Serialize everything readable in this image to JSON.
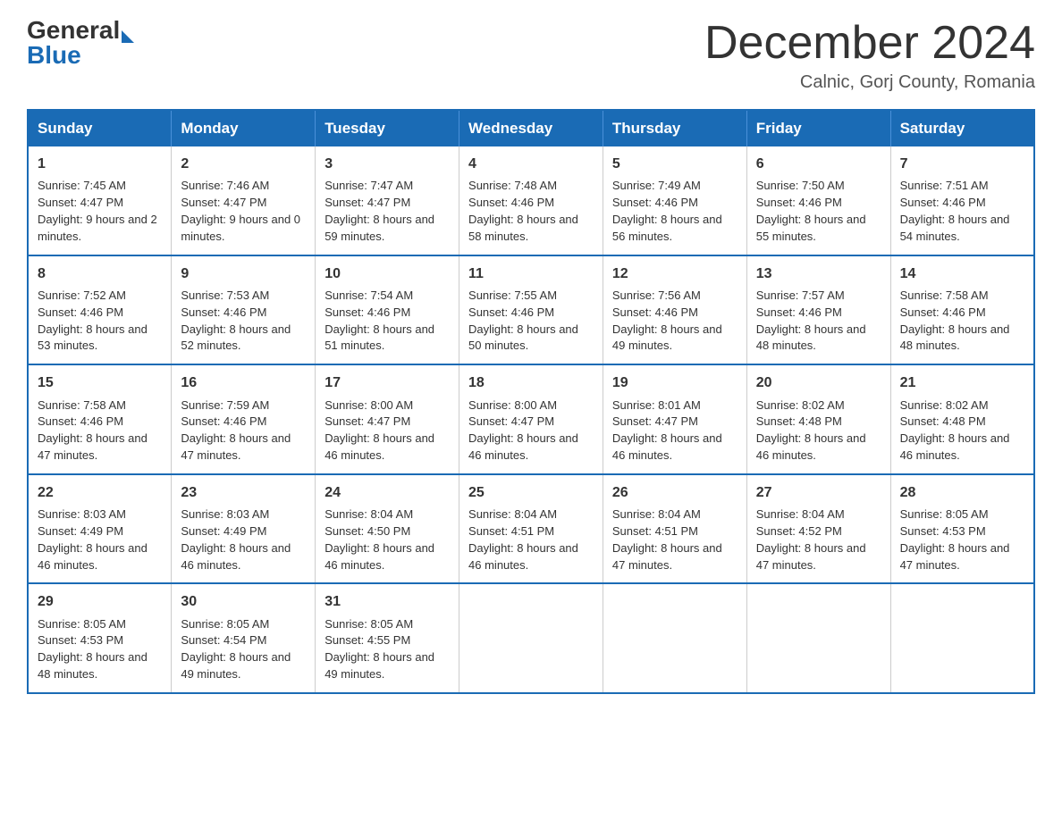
{
  "header": {
    "logo": {
      "general": "General",
      "blue": "Blue",
      "arrow_color": "#1a6bb5"
    },
    "title": "December 2024",
    "subtitle": "Calnic, Gorj County, Romania"
  },
  "days_of_week": [
    "Sunday",
    "Monday",
    "Tuesday",
    "Wednesday",
    "Thursday",
    "Friday",
    "Saturday"
  ],
  "weeks": [
    [
      {
        "day": "1",
        "sunrise": "7:45 AM",
        "sunset": "4:47 PM",
        "daylight": "9 hours and 2 minutes."
      },
      {
        "day": "2",
        "sunrise": "7:46 AM",
        "sunset": "4:47 PM",
        "daylight": "9 hours and 0 minutes."
      },
      {
        "day": "3",
        "sunrise": "7:47 AM",
        "sunset": "4:47 PM",
        "daylight": "8 hours and 59 minutes."
      },
      {
        "day": "4",
        "sunrise": "7:48 AM",
        "sunset": "4:46 PM",
        "daylight": "8 hours and 58 minutes."
      },
      {
        "day": "5",
        "sunrise": "7:49 AM",
        "sunset": "4:46 PM",
        "daylight": "8 hours and 56 minutes."
      },
      {
        "day": "6",
        "sunrise": "7:50 AM",
        "sunset": "4:46 PM",
        "daylight": "8 hours and 55 minutes."
      },
      {
        "day": "7",
        "sunrise": "7:51 AM",
        "sunset": "4:46 PM",
        "daylight": "8 hours and 54 minutes."
      }
    ],
    [
      {
        "day": "8",
        "sunrise": "7:52 AM",
        "sunset": "4:46 PM",
        "daylight": "8 hours and 53 minutes."
      },
      {
        "day": "9",
        "sunrise": "7:53 AM",
        "sunset": "4:46 PM",
        "daylight": "8 hours and 52 minutes."
      },
      {
        "day": "10",
        "sunrise": "7:54 AM",
        "sunset": "4:46 PM",
        "daylight": "8 hours and 51 minutes."
      },
      {
        "day": "11",
        "sunrise": "7:55 AM",
        "sunset": "4:46 PM",
        "daylight": "8 hours and 50 minutes."
      },
      {
        "day": "12",
        "sunrise": "7:56 AM",
        "sunset": "4:46 PM",
        "daylight": "8 hours and 49 minutes."
      },
      {
        "day": "13",
        "sunrise": "7:57 AM",
        "sunset": "4:46 PM",
        "daylight": "8 hours and 48 minutes."
      },
      {
        "day": "14",
        "sunrise": "7:58 AM",
        "sunset": "4:46 PM",
        "daylight": "8 hours and 48 minutes."
      }
    ],
    [
      {
        "day": "15",
        "sunrise": "7:58 AM",
        "sunset": "4:46 PM",
        "daylight": "8 hours and 47 minutes."
      },
      {
        "day": "16",
        "sunrise": "7:59 AM",
        "sunset": "4:46 PM",
        "daylight": "8 hours and 47 minutes."
      },
      {
        "day": "17",
        "sunrise": "8:00 AM",
        "sunset": "4:47 PM",
        "daylight": "8 hours and 46 minutes."
      },
      {
        "day": "18",
        "sunrise": "8:00 AM",
        "sunset": "4:47 PM",
        "daylight": "8 hours and 46 minutes."
      },
      {
        "day": "19",
        "sunrise": "8:01 AM",
        "sunset": "4:47 PM",
        "daylight": "8 hours and 46 minutes."
      },
      {
        "day": "20",
        "sunrise": "8:02 AM",
        "sunset": "4:48 PM",
        "daylight": "8 hours and 46 minutes."
      },
      {
        "day": "21",
        "sunrise": "8:02 AM",
        "sunset": "4:48 PM",
        "daylight": "8 hours and 46 minutes."
      }
    ],
    [
      {
        "day": "22",
        "sunrise": "8:03 AM",
        "sunset": "4:49 PM",
        "daylight": "8 hours and 46 minutes."
      },
      {
        "day": "23",
        "sunrise": "8:03 AM",
        "sunset": "4:49 PM",
        "daylight": "8 hours and 46 minutes."
      },
      {
        "day": "24",
        "sunrise": "8:04 AM",
        "sunset": "4:50 PM",
        "daylight": "8 hours and 46 minutes."
      },
      {
        "day": "25",
        "sunrise": "8:04 AM",
        "sunset": "4:51 PM",
        "daylight": "8 hours and 46 minutes."
      },
      {
        "day": "26",
        "sunrise": "8:04 AM",
        "sunset": "4:51 PM",
        "daylight": "8 hours and 47 minutes."
      },
      {
        "day": "27",
        "sunrise": "8:04 AM",
        "sunset": "4:52 PM",
        "daylight": "8 hours and 47 minutes."
      },
      {
        "day": "28",
        "sunrise": "8:05 AM",
        "sunset": "4:53 PM",
        "daylight": "8 hours and 47 minutes."
      }
    ],
    [
      {
        "day": "29",
        "sunrise": "8:05 AM",
        "sunset": "4:53 PM",
        "daylight": "8 hours and 48 minutes."
      },
      {
        "day": "30",
        "sunrise": "8:05 AM",
        "sunset": "4:54 PM",
        "daylight": "8 hours and 49 minutes."
      },
      {
        "day": "31",
        "sunrise": "8:05 AM",
        "sunset": "4:55 PM",
        "daylight": "8 hours and 49 minutes."
      },
      null,
      null,
      null,
      null
    ]
  ]
}
